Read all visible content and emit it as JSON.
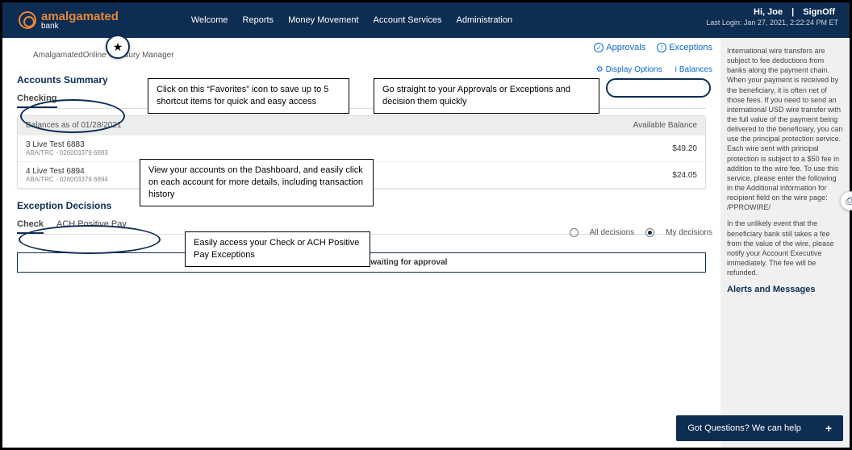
{
  "brand": {
    "name": "amalgamated",
    "sub": "bank"
  },
  "nav": {
    "items": [
      "Welcome",
      "Reports",
      "Money Movement",
      "Account Services",
      "Administration"
    ]
  },
  "user": {
    "greeting": "Hi, Joe",
    "signoff": "SignOff",
    "last_login": "Last Login: Jan 27, 2021, 2:22:24 PM ET"
  },
  "subtitle": "AmalgamatedOnline Treasury Manager",
  "callouts": {
    "fav": "Click on this “Favorites” icon to save up to 5 shortcut items for quick and easy access",
    "approvals": "Go straight to your Approvals or Exceptions and decision them quickly",
    "accounts": "View your accounts on the Dashboard, and easily click on each account for more details, including transaction history",
    "exceptions": "Easily access your Check or ACH Positive Pay Exceptions"
  },
  "quicklinks": {
    "approvals": "Approvals",
    "exceptions": "Exceptions",
    "display_options": "Display Options",
    "balances": "Balances"
  },
  "accounts_summary": {
    "header": "Accounts Summary",
    "tab": "Checking",
    "asof": "Balances as of 01/28/2021",
    "col_balance": "Available Balance",
    "rows": [
      {
        "name": "3 Live Test 6883",
        "detail": "ABA/TRC - 026003379\n6883",
        "balance": "$49.20"
      },
      {
        "name": "4 Live Test 6894",
        "detail": "ABA/TRC - 026003379\n6894",
        "balance": "$24.05"
      }
    ]
  },
  "exception_section": {
    "header": "Exception Decisions",
    "tabs": [
      "Check",
      "ACH Positive Pay"
    ],
    "radio_all": "All decisions",
    "radio_my": "My decisions",
    "empty": "There are no exceptions waiting for approval"
  },
  "sidepanel": {
    "p1": "International wire transfers are subject to fee deductions from banks along the payment chain. When your payment is received by the beneficiary, it is often net of those fees. If you need to send an international USD wire transfer with the full value of the payment being delivered to the beneficiary, you can use the principal protection service. Each wire sent with principal protection is subject to a $50 fee in addition to the wire fee. To use this service, please enter the following in the Additional information for recipient field on the wire page: /PPROWIRE/",
    "p2": "In the unlikely event that the beneficiary bank still takes a fee from the value of the wire, please notify your Account Executive immediately. The fee will be refunded.",
    "alerts": "Alerts and Messages"
  },
  "help": {
    "label": "Got Questions? We can help"
  }
}
